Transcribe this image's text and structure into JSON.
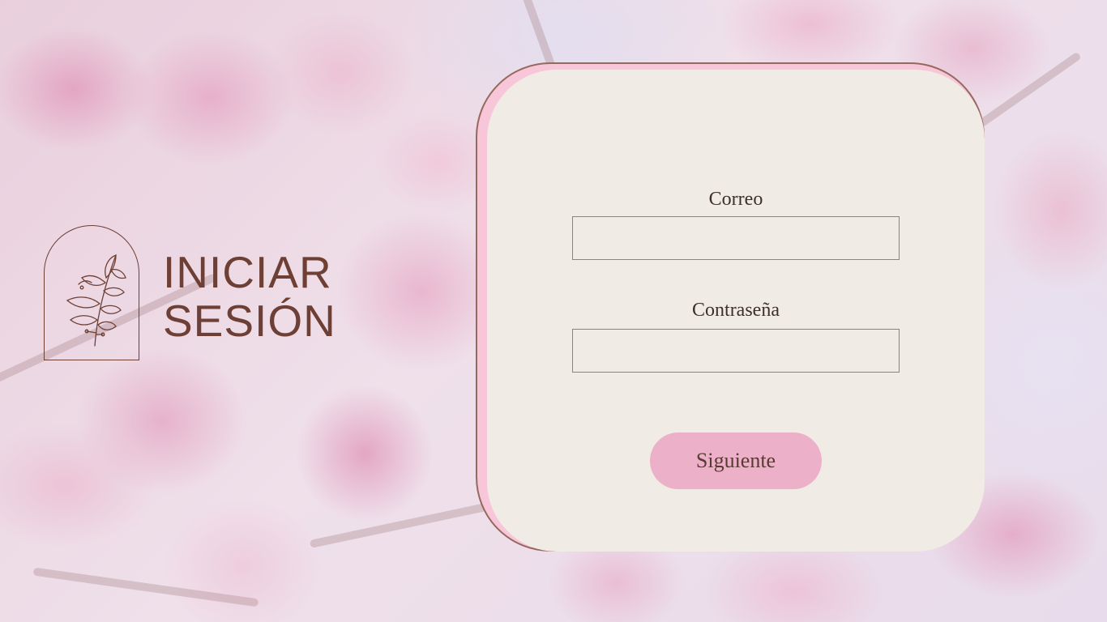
{
  "page": {
    "title_line1": "INICIAR",
    "title_line2": "SESIÓN"
  },
  "form": {
    "email_label": "Correo",
    "email_value": "",
    "password_label": "Contraseña",
    "password_value": "",
    "submit_label": "Siguiente"
  },
  "icons": {
    "logo": "leafy-branch-icon"
  },
  "colors": {
    "accent_brown": "#6e4035",
    "card_background": "#f0ebe5",
    "card_accent_pink": "#f7c6d8",
    "button_pink": "#ecb0c8"
  }
}
